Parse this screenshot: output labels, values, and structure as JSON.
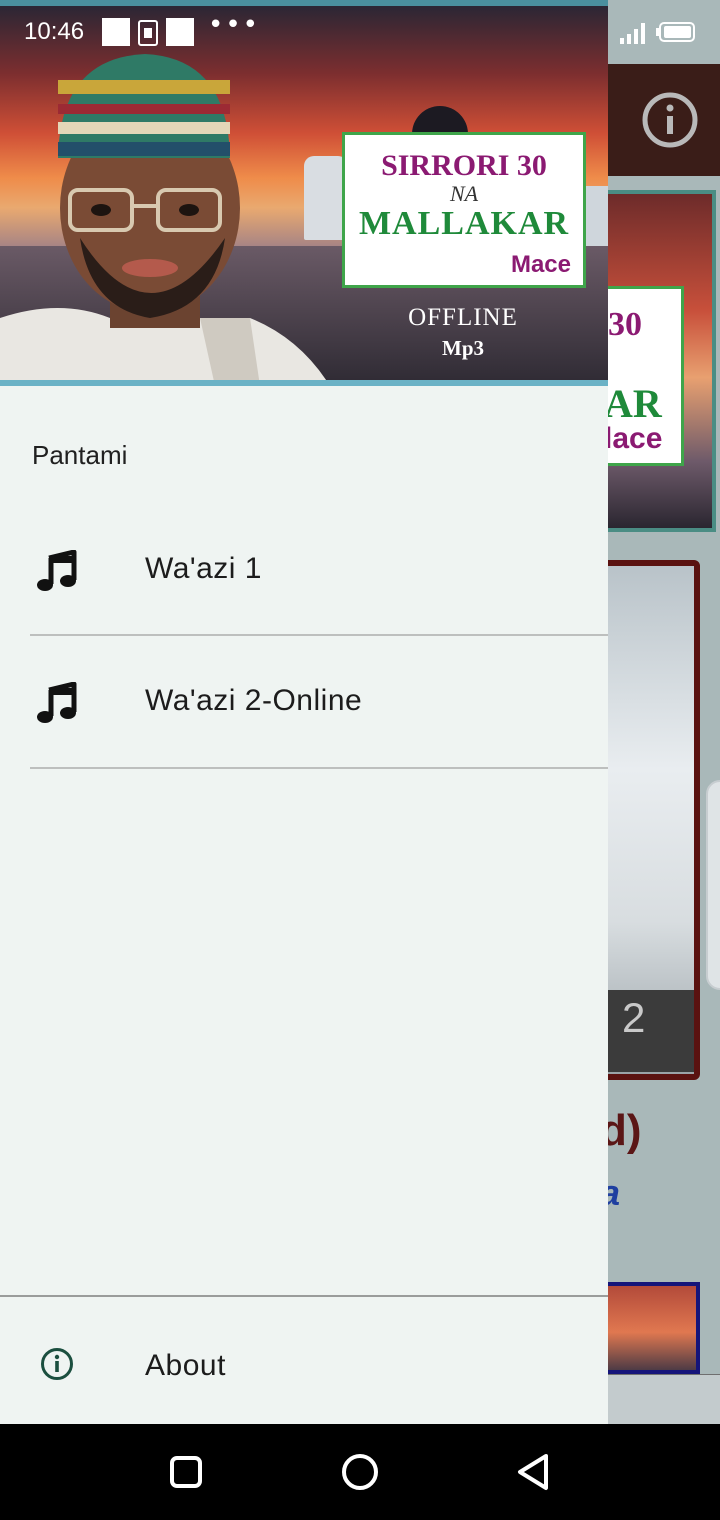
{
  "status_bar": {
    "time": "10:46",
    "overflow_dots": "•••",
    "signal_icon": "signal-icon",
    "battery_icon": "battery-icon"
  },
  "header": {
    "card_title_line1": "SIRRORI 30",
    "card_title_line2": "NA",
    "card_title_line3": "MALLAKAR",
    "card_title_line4": "Mace",
    "offline": "OFFLINE",
    "format": "Mp3"
  },
  "drawer": {
    "subtitle": "Pantami",
    "items": [
      {
        "label": "Wa'azi 1",
        "icon": "music-note-icon"
      },
      {
        "label": "Wa'azi 2-Online",
        "icon": "music-note-icon"
      }
    ],
    "footer_item": {
      "label": "About",
      "icon": "info-icon"
    }
  },
  "background_app": {
    "card_number": "2",
    "text_fragment_1": "d)",
    "text_fragment_2": "a"
  },
  "colors": {
    "drawer_bg": "#eff4f2",
    "toolbar_bg": "#3a1d18",
    "card_purple": "#8b1a72",
    "card_green": "#1f8a3a"
  }
}
